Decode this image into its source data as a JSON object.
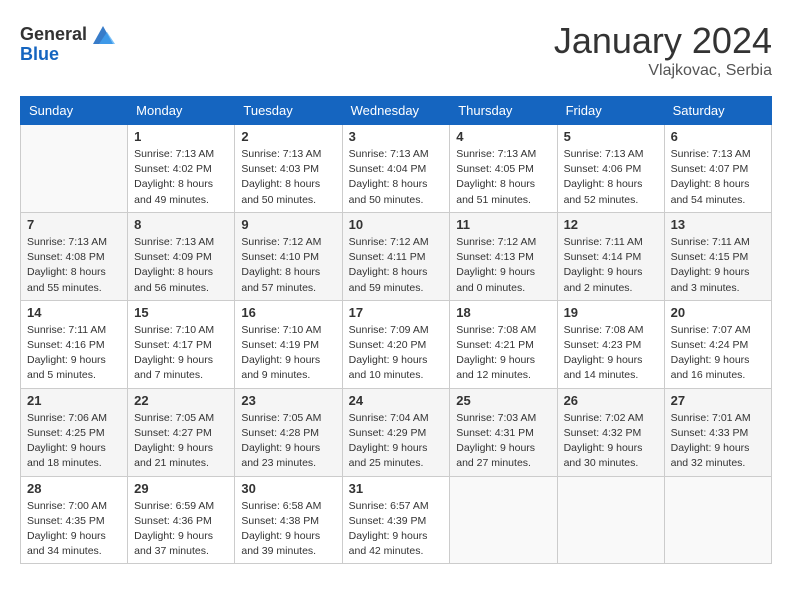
{
  "logo": {
    "text_general": "General",
    "text_blue": "Blue"
  },
  "title": "January 2024",
  "location": "Vlajkovac, Serbia",
  "days_of_week": [
    "Sunday",
    "Monday",
    "Tuesday",
    "Wednesday",
    "Thursday",
    "Friday",
    "Saturday"
  ],
  "weeks": [
    [
      {
        "day": "",
        "info": ""
      },
      {
        "day": "1",
        "info": "Sunrise: 7:13 AM\nSunset: 4:02 PM\nDaylight: 8 hours\nand 49 minutes."
      },
      {
        "day": "2",
        "info": "Sunrise: 7:13 AM\nSunset: 4:03 PM\nDaylight: 8 hours\nand 50 minutes."
      },
      {
        "day": "3",
        "info": "Sunrise: 7:13 AM\nSunset: 4:04 PM\nDaylight: 8 hours\nand 50 minutes."
      },
      {
        "day": "4",
        "info": "Sunrise: 7:13 AM\nSunset: 4:05 PM\nDaylight: 8 hours\nand 51 minutes."
      },
      {
        "day": "5",
        "info": "Sunrise: 7:13 AM\nSunset: 4:06 PM\nDaylight: 8 hours\nand 52 minutes."
      },
      {
        "day": "6",
        "info": "Sunrise: 7:13 AM\nSunset: 4:07 PM\nDaylight: 8 hours\nand 54 minutes."
      }
    ],
    [
      {
        "day": "7",
        "info": "Sunrise: 7:13 AM\nSunset: 4:08 PM\nDaylight: 8 hours\nand 55 minutes."
      },
      {
        "day": "8",
        "info": "Sunrise: 7:13 AM\nSunset: 4:09 PM\nDaylight: 8 hours\nand 56 minutes."
      },
      {
        "day": "9",
        "info": "Sunrise: 7:12 AM\nSunset: 4:10 PM\nDaylight: 8 hours\nand 57 minutes."
      },
      {
        "day": "10",
        "info": "Sunrise: 7:12 AM\nSunset: 4:11 PM\nDaylight: 8 hours\nand 59 minutes."
      },
      {
        "day": "11",
        "info": "Sunrise: 7:12 AM\nSunset: 4:13 PM\nDaylight: 9 hours\nand 0 minutes."
      },
      {
        "day": "12",
        "info": "Sunrise: 7:11 AM\nSunset: 4:14 PM\nDaylight: 9 hours\nand 2 minutes."
      },
      {
        "day": "13",
        "info": "Sunrise: 7:11 AM\nSunset: 4:15 PM\nDaylight: 9 hours\nand 3 minutes."
      }
    ],
    [
      {
        "day": "14",
        "info": "Sunrise: 7:11 AM\nSunset: 4:16 PM\nDaylight: 9 hours\nand 5 minutes."
      },
      {
        "day": "15",
        "info": "Sunrise: 7:10 AM\nSunset: 4:17 PM\nDaylight: 9 hours\nand 7 minutes."
      },
      {
        "day": "16",
        "info": "Sunrise: 7:10 AM\nSunset: 4:19 PM\nDaylight: 9 hours\nand 9 minutes."
      },
      {
        "day": "17",
        "info": "Sunrise: 7:09 AM\nSunset: 4:20 PM\nDaylight: 9 hours\nand 10 minutes."
      },
      {
        "day": "18",
        "info": "Sunrise: 7:08 AM\nSunset: 4:21 PM\nDaylight: 9 hours\nand 12 minutes."
      },
      {
        "day": "19",
        "info": "Sunrise: 7:08 AM\nSunset: 4:23 PM\nDaylight: 9 hours\nand 14 minutes."
      },
      {
        "day": "20",
        "info": "Sunrise: 7:07 AM\nSunset: 4:24 PM\nDaylight: 9 hours\nand 16 minutes."
      }
    ],
    [
      {
        "day": "21",
        "info": "Sunrise: 7:06 AM\nSunset: 4:25 PM\nDaylight: 9 hours\nand 18 minutes."
      },
      {
        "day": "22",
        "info": "Sunrise: 7:05 AM\nSunset: 4:27 PM\nDaylight: 9 hours\nand 21 minutes."
      },
      {
        "day": "23",
        "info": "Sunrise: 7:05 AM\nSunset: 4:28 PM\nDaylight: 9 hours\nand 23 minutes."
      },
      {
        "day": "24",
        "info": "Sunrise: 7:04 AM\nSunset: 4:29 PM\nDaylight: 9 hours\nand 25 minutes."
      },
      {
        "day": "25",
        "info": "Sunrise: 7:03 AM\nSunset: 4:31 PM\nDaylight: 9 hours\nand 27 minutes."
      },
      {
        "day": "26",
        "info": "Sunrise: 7:02 AM\nSunset: 4:32 PM\nDaylight: 9 hours\nand 30 minutes."
      },
      {
        "day": "27",
        "info": "Sunrise: 7:01 AM\nSunset: 4:33 PM\nDaylight: 9 hours\nand 32 minutes."
      }
    ],
    [
      {
        "day": "28",
        "info": "Sunrise: 7:00 AM\nSunset: 4:35 PM\nDaylight: 9 hours\nand 34 minutes."
      },
      {
        "day": "29",
        "info": "Sunrise: 6:59 AM\nSunset: 4:36 PM\nDaylight: 9 hours\nand 37 minutes."
      },
      {
        "day": "30",
        "info": "Sunrise: 6:58 AM\nSunset: 4:38 PM\nDaylight: 9 hours\nand 39 minutes."
      },
      {
        "day": "31",
        "info": "Sunrise: 6:57 AM\nSunset: 4:39 PM\nDaylight: 9 hours\nand 42 minutes."
      },
      {
        "day": "",
        "info": ""
      },
      {
        "day": "",
        "info": ""
      },
      {
        "day": "",
        "info": ""
      }
    ]
  ]
}
